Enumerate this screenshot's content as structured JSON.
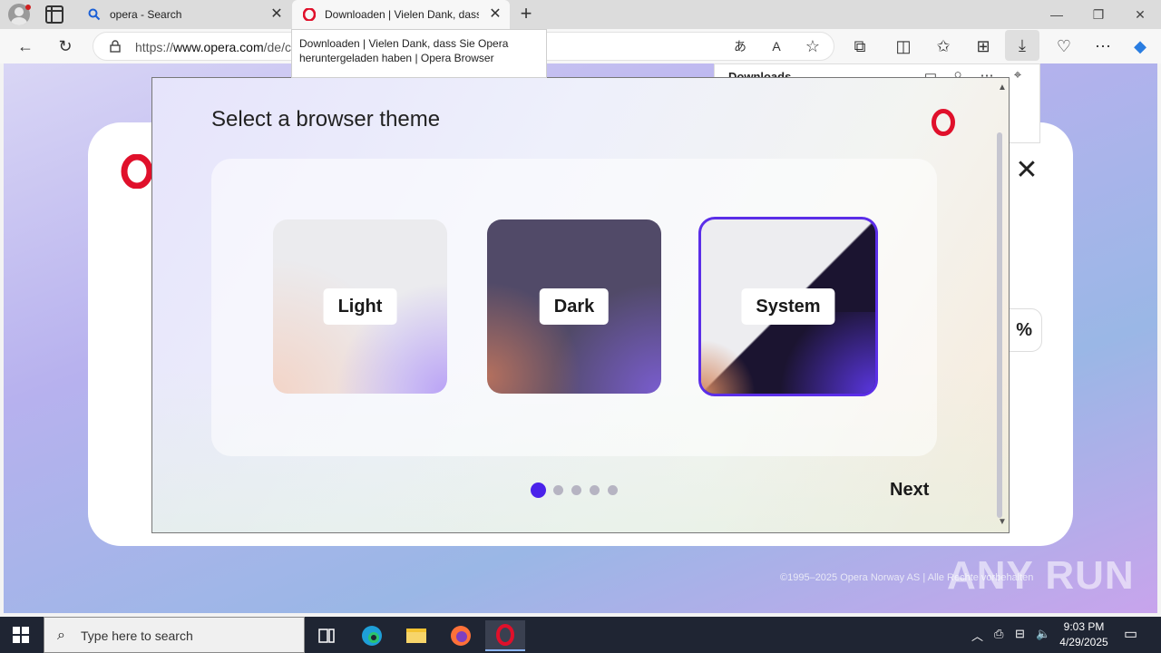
{
  "tabs": [
    {
      "label": "opera - Search",
      "icon": "search-icon"
    },
    {
      "label": "Downloaden | Vielen Dank, dass Sie Opera heruntergeladen haben | Opera Browser",
      "icon": "opera-icon"
    }
  ],
  "tooltip": "Downloaden | Vielen Dank, dass Sie Opera heruntergeladen haben | Opera Browser",
  "address": {
    "prefix": "https://",
    "domain": "www.opera.com",
    "path": "/de/c"
  },
  "downloads_panel": {
    "title": "Downloads"
  },
  "installer": {
    "title": "Select a browser theme",
    "themes": [
      {
        "label": "Light",
        "selected": false
      },
      {
        "label": "Dark",
        "selected": false
      },
      {
        "label": "System",
        "selected": true
      }
    ],
    "steps_total": 5,
    "step_current": 1,
    "next_label": "Next"
  },
  "page": {
    "footer": "©1995–2025 Opera Norway AS | Alle Rechte vorbehalten",
    "percent_fragment": "%"
  },
  "watermark": "ANY RUN",
  "taskbar": {
    "search_placeholder": "Type here to search",
    "time": "9:03 PM",
    "date": "4/29/2025"
  },
  "colors": {
    "accent": "#4a22ea",
    "opera_red": "#e0102b"
  }
}
